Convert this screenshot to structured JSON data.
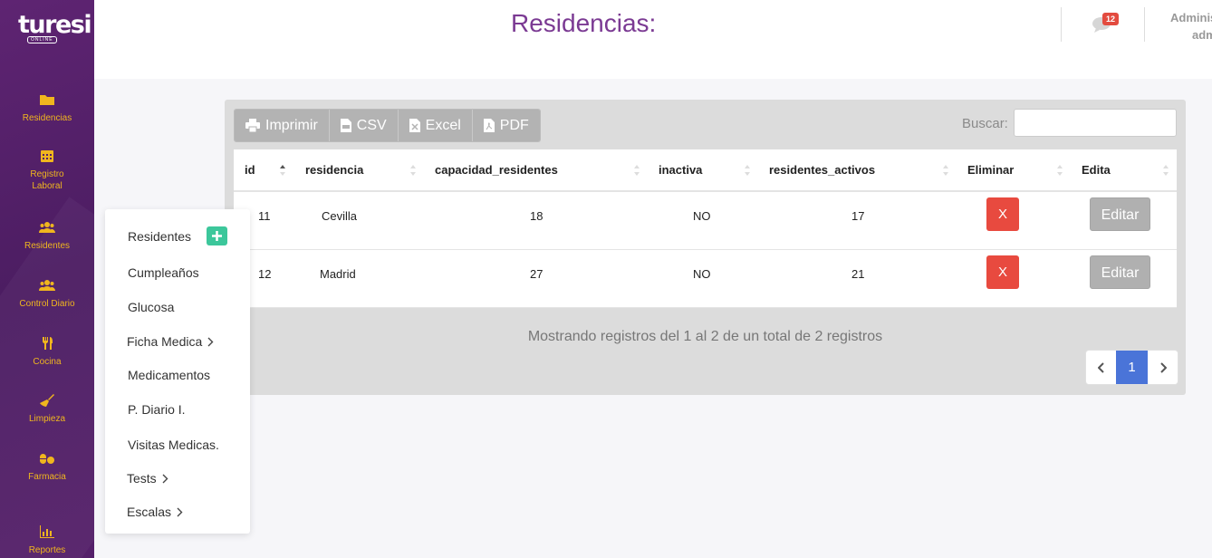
{
  "brand": {
    "logo_text": "turesi",
    "logo_sub": "ONLINE"
  },
  "sidebar": {
    "items": [
      {
        "label": "Residencias",
        "icon": "folder-icon"
      },
      {
        "label": "Registro Laboral",
        "icon": "calendar-icon"
      },
      {
        "label": "Residentes",
        "icon": "users-icon"
      },
      {
        "label": "Control Diario",
        "icon": "users-icon"
      },
      {
        "label": "Cocina",
        "icon": "utensils-icon"
      },
      {
        "label": "Limpieza",
        "icon": "broom-icon"
      },
      {
        "label": "Farmacia",
        "icon": "pills-icon"
      },
      {
        "label": "Reportes",
        "icon": "bar-chart-icon"
      }
    ]
  },
  "header": {
    "title": "Residencias:",
    "notifications_count": "12",
    "user_line1": "Adminis",
    "user_line2": "adm"
  },
  "toolbar": {
    "print_label": "Imprimir",
    "csv_label": "CSV",
    "excel_label": "Excel",
    "pdf_label": "PDF",
    "search_label": "Buscar:",
    "search_value": ""
  },
  "table": {
    "columns": [
      "id",
      "residencia",
      "capacidad_residentes",
      "inactiva",
      "residentes_activos",
      "Eliminar",
      "Edita"
    ],
    "rows": [
      {
        "id": "11",
        "residencia": "Cevilla",
        "capacidad": "18",
        "inactiva": "NO",
        "activos": "17",
        "delete_label": "X",
        "edit_label": "Editar"
      },
      {
        "id": "12",
        "residencia": "Madrid",
        "capacidad": "27",
        "inactiva": "NO",
        "activos": "21",
        "delete_label": "X",
        "edit_label": "Editar"
      }
    ],
    "info": "Mostrando registros del 1 al 2 de un total de 2 registros",
    "current_page": "1"
  },
  "submenu": {
    "items": [
      {
        "label": "Residentes"
      },
      {
        "label": "Cumpleaños"
      },
      {
        "label": "Glucosa"
      },
      {
        "label": "Ficha Medica"
      },
      {
        "label": "Medicamentos"
      },
      {
        "label": "P. Diario I."
      },
      {
        "label": "Visitas Medicas."
      },
      {
        "label": "Tests"
      },
      {
        "label": "Escalas"
      }
    ]
  },
  "colors": {
    "sidebar": "#55206a",
    "sidebar_text": "#f0b61e",
    "title": "#7b3a93",
    "delete": "#e84a3f",
    "page_active": "#4a74d8",
    "add": "#3cc79b"
  }
}
